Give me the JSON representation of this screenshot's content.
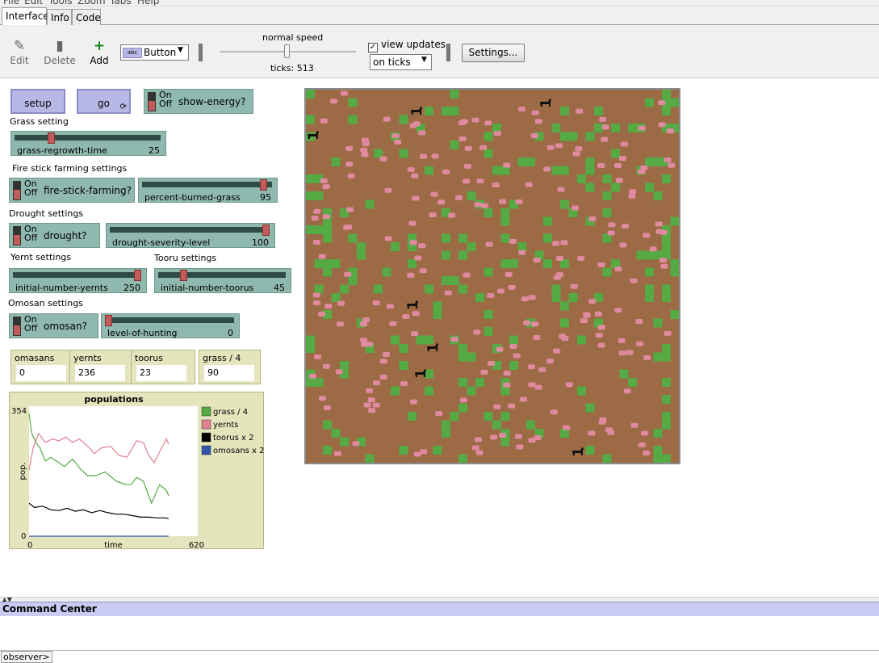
{
  "menu": [
    "File",
    "Edit",
    "Tools",
    "Zoom",
    "Tabs",
    "Help"
  ],
  "tabs": [
    "Interface",
    "Info",
    "Code"
  ],
  "toolbar": {
    "edit": "Edit",
    "delete": "Delete",
    "add": "Add",
    "widget_type": "Button",
    "speed_label": "normal speed",
    "ticks": "ticks: 513",
    "view_updates": "view updates",
    "update_mode": "on ticks",
    "settings": "Settings..."
  },
  "controls": {
    "setup": "setup",
    "go": "go",
    "on_label": "On",
    "off_label": "Off",
    "show_energy": "show-energy?",
    "grass_setting": "Grass setting",
    "grass_regrowth": {
      "name": "grass-regrowth-time",
      "value": "25",
      "fraction": 0.24
    },
    "fire_settings": "Fire stick farming settings",
    "fire_switch": "fire-stick-farming?",
    "percent_burned": {
      "name": "percent-burned-grass",
      "value": "95",
      "fraction": 0.96
    },
    "drought_settings": "Drought settings",
    "drought_switch": "drought?",
    "drought_level": {
      "name": "drought-severity-level",
      "value": "100",
      "fraction": 1.0
    },
    "yernt_settings": "Yernt settings",
    "tooru_settings": "Tooru settings",
    "initial_yernts": {
      "name": "initial-number-yernts",
      "value": "250",
      "fraction": 1.0
    },
    "initial_toorus": {
      "name": "initial-number-toorus",
      "value": "45",
      "fraction": 0.18
    },
    "omosan_settings": "Omosan settings",
    "omosan_switch": "omosan?",
    "hunting": {
      "name": "level-of-hunting",
      "value": "0",
      "fraction": 0.0
    }
  },
  "monitors": [
    {
      "name": "omasans",
      "value": "0"
    },
    {
      "name": "yernts",
      "value": "236"
    },
    {
      "name": "toorus",
      "value": "23"
    },
    {
      "name": "grass / 4",
      "value": "90"
    }
  ],
  "chart_data": {
    "type": "line",
    "title": "populations",
    "xlabel": "time",
    "ylabel": "pop.",
    "xlim": [
      0,
      620
    ],
    "ylim": [
      0,
      354
    ],
    "x_tick_labels": [
      "0",
      "620"
    ],
    "y_tick_labels": [
      "0",
      "354"
    ],
    "legend": "right",
    "series": [
      {
        "name": "grass / 4",
        "color": "#55aa44",
        "x": [
          0,
          10,
          25,
          40,
          60,
          80,
          100,
          130,
          160,
          190,
          215,
          245,
          280,
          320,
          350,
          375,
          395,
          420,
          450,
          480,
          505,
          513
        ],
        "y": [
          334,
          280,
          255,
          240,
          205,
          215,
          205,
          190,
          210,
          182,
          165,
          165,
          175,
          150,
          142,
          140,
          160,
          150,
          90,
          140,
          125,
          110
        ]
      },
      {
        "name": "yernts",
        "color": "#e08090",
        "x": [
          0,
          15,
          35,
          60,
          85,
          110,
          135,
          160,
          185,
          215,
          240,
          265,
          300,
          330,
          360,
          395,
          420,
          440,
          460,
          480,
          505,
          513
        ],
        "y": [
          180,
          240,
          280,
          255,
          265,
          260,
          270,
          255,
          265,
          245,
          225,
          240,
          245,
          220,
          215,
          260,
          255,
          220,
          200,
          230,
          265,
          250
        ]
      },
      {
        "name": "toorus x 2",
        "color": "#000000",
        "x": [
          0,
          20,
          50,
          80,
          110,
          140,
          170,
          200,
          230,
          260,
          290,
          320,
          350,
          380,
          410,
          440,
          470,
          500,
          513
        ],
        "y": [
          90,
          78,
          82,
          72,
          70,
          76,
          68,
          72,
          64,
          70,
          64,
          60,
          60,
          56,
          52,
          52,
          50,
          50,
          48
        ]
      },
      {
        "name": "omosans x 2",
        "color": "#3355aa",
        "x": [
          0,
          513
        ],
        "y": [
          0,
          0
        ]
      }
    ]
  },
  "command_center": {
    "title": "Command Center",
    "observer": "observer>"
  },
  "colors": {
    "patch_brown": "#9c6a45",
    "grass_green": "#55aa44",
    "sheep_pink": "#e08aa0",
    "wolf_black": "#111111"
  }
}
